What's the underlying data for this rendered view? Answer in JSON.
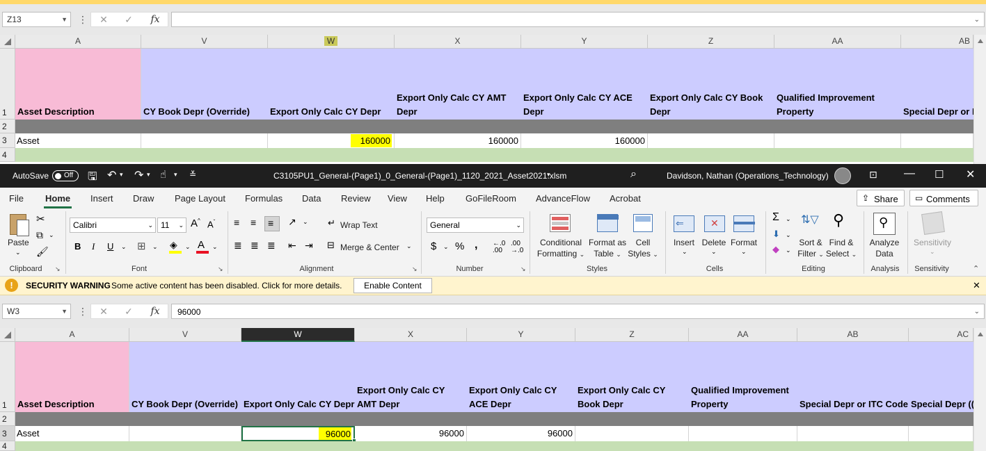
{
  "top_window": {
    "name_box": "Z13",
    "formula_value": "",
    "columns": [
      "A",
      "V",
      "W",
      "X",
      "Y",
      "Z",
      "AA",
      "AB"
    ],
    "rows": [
      "1",
      "2",
      "3",
      "4"
    ],
    "headers": [
      "Asset Description",
      "CY Book Depr (Override)",
      "Export Only Calc CY Depr",
      "Export Only Calc CY AMT Depr",
      "Export Only Calc CY ACE Depr",
      "Export Only Calc CY Book Depr",
      "Qualified Improvement Property",
      "Special Depr or I"
    ],
    "row3": [
      "Asset",
      "",
      "160000",
      "160000",
      "160000",
      "",
      "",
      ""
    ]
  },
  "titlebar": {
    "autosave_label": "AutoSave",
    "autosave_state": "Off",
    "filename": "C3105PU1_General-(Page1)_0_General-(Page1)_1120_2021_Asset2021.xlsm",
    "user": "Davidson, Nathan (Operations_Technology)"
  },
  "tabs": [
    "File",
    "Home",
    "Insert",
    "Draw",
    "Page Layout",
    "Formulas",
    "Data",
    "Review",
    "View",
    "Help",
    "GoFileRoom",
    "AdvanceFlow",
    "Acrobat"
  ],
  "active_tab": "Home",
  "share_label": "Share",
  "comments_label": "Comments",
  "ribbon": {
    "paste": "Paste",
    "clipboard": "Clipboard",
    "font_name": "Calibri",
    "font_size": "11",
    "font": "Font",
    "wrap_text": "Wrap Text",
    "merge_center": "Merge & Center",
    "alignment": "Alignment",
    "number_format": "General",
    "number": "Number",
    "conditional_formatting": [
      "Conditional",
      "Formatting"
    ],
    "format_as_table": [
      "Format as",
      "Table"
    ],
    "cell_styles": [
      "Cell",
      "Styles"
    ],
    "styles": "Styles",
    "insert": "Insert",
    "delete": "Delete",
    "format": "Format",
    "cells": "Cells",
    "sort_filter": [
      "Sort &",
      "Filter"
    ],
    "find_select": [
      "Find &",
      "Select"
    ],
    "editing": "Editing",
    "analyze_data": [
      "Analyze",
      "Data"
    ],
    "analysis": "Analysis",
    "sensitivity_btn": "Sensitivity",
    "sensitivity": "Sensitivity"
  },
  "security": {
    "title": "SECURITY WARNING",
    "message": "Some active content has been disabled. Click for more details.",
    "button": "Enable Content"
  },
  "bottom_window": {
    "name_box": "W3",
    "formula_value": "96000",
    "columns": [
      "A",
      "V",
      "W",
      "X",
      "Y",
      "Z",
      "AA",
      "AB",
      "AC"
    ],
    "rows": [
      "1",
      "2",
      "3",
      "4"
    ],
    "headers": [
      "Asset Description",
      "CY Book Depr (Override)",
      "Export Only Calc CY Depr",
      "Export Only Calc CY AMT Depr",
      "Export Only Calc CY ACE Depr",
      "Export Only Calc CY Book Depr",
      "Qualified Improvement Property",
      "Special Depr or ITC Code",
      "Special Depr (("
    ],
    "row3": [
      "Asset",
      "",
      "96000",
      "96000",
      "96000",
      "",
      "",
      "",
      ""
    ]
  },
  "colors": {
    "pink": "#f8bbd6",
    "lavender": "#ccccff",
    "gray_row": "#7f7f7f",
    "green_row": "#c6dfb4",
    "yellow": "#ffff00"
  }
}
